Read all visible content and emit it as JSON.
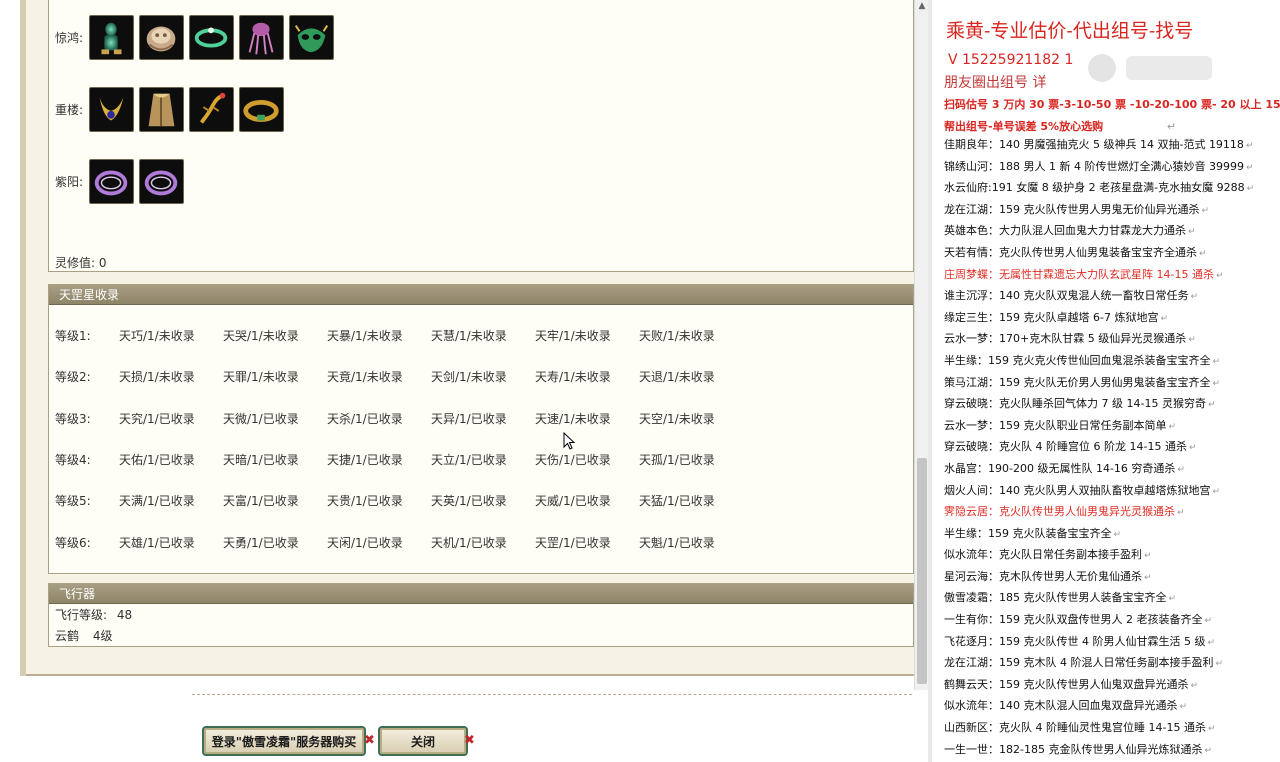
{
  "items": {
    "rows": [
      {
        "label": "惊鸿:",
        "icons": [
          "jade-figure-icon",
          "golden-hat-icon",
          "jade-ring-icon",
          "purple-squid-icon",
          "jade-mask-icon"
        ]
      },
      {
        "label": "重楼:",
        "icons": [
          "golden-horn-icon",
          "bronze-cloak-icon",
          "golden-scorpion-icon",
          "golden-belt-icon"
        ]
      },
      {
        "label": "紫阳:",
        "icons": [
          "purple-bracelet-icon",
          "purple-bracelet-icon"
        ]
      }
    ],
    "lingxiu_label": "灵修值:",
    "lingxiu_value": "0"
  },
  "tiangang": {
    "header": "天罡星收录",
    "rows": [
      {
        "level": "等级1:",
        "cells": [
          "天巧/1/未收录",
          "天哭/1/未收录",
          "天暴/1/未收录",
          "天慧/1/未收录",
          "天牢/1/未收录",
          "天败/1/未收录"
        ]
      },
      {
        "level": "等级2:",
        "cells": [
          "天损/1/未收录",
          "天罪/1/未收录",
          "天竟/1/未收录",
          "天剑/1/未收录",
          "天寿/1/未收录",
          "天退/1/未收录"
        ]
      },
      {
        "level": "等级3:",
        "cells": [
          "天究/1/已收录",
          "天微/1/已收录",
          "天杀/1/已收录",
          "天异/1/已收录",
          "天速/1/未收录",
          "天空/1/未收录"
        ]
      },
      {
        "level": "等级4:",
        "cells": [
          "天佑/1/已收录",
          "天暗/1/已收录",
          "天捷/1/已收录",
          "天立/1/已收录",
          "天伤/1/已收录",
          "天孤/1/已收录"
        ]
      },
      {
        "level": "等级5:",
        "cells": [
          "天满/1/已收录",
          "天富/1/已收录",
          "天贵/1/已收录",
          "天英/1/已收录",
          "天威/1/已收录",
          "天猛/1/已收录"
        ]
      },
      {
        "level": "等级6:",
        "cells": [
          "天雄/1/已收录",
          "天勇/1/已收录",
          "天闲/1/已收录",
          "天机/1/已收录",
          "天罡/1/已收录",
          "天魁/1/已收录"
        ]
      }
    ]
  },
  "flight": {
    "header": "飞行器",
    "level_label": "飞行等级:",
    "level_value": "48",
    "crane_label": "云鹤",
    "crane_value": "4级"
  },
  "buttons": {
    "buy_label": "登录\"傲雪凌霜\"服务器购买",
    "close_label": "关闭",
    "x_mark": "✖"
  },
  "right": {
    "title": "乘黄-专业估价-代出组号-找号",
    "phone": "V 15225921182    1",
    "circle": "朋友圈出组号    详",
    "price_line": "扫码估号 3 万内 30 票-3-10-50 票  -10-20-100 票- 20 以上 150",
    "help_line": "帮出组号-单号误差 5%放心选购",
    "return_mark": "↵",
    "list": [
      {
        "text": "佳期良年：140 男魔强抽克火 5 级神兵 14 双抽-范式 19118",
        "red": false
      },
      {
        "text": "锦绣山河：188 男人 1 新 4 阶传世燃灯全满心猿妙音 39999",
        "red": false
      },
      {
        "text": "水云仙府:191 女魔 8 级护身 2 老孩星盘满-克水抽女魔 9288",
        "red": false
      },
      {
        "text": "龙在江湖：159 克火队传世男人男鬼无价仙异光通杀",
        "red": false
      },
      {
        "text": "英雄本色：大力队混人回血鬼大力甘霖龙大力通杀",
        "red": false
      },
      {
        "text": "天若有情：克火队传世男人仙男鬼装备宝宝齐全通杀",
        "red": false
      },
      {
        "text": "庄周梦蝶：无属性甘霖遗忘大力队玄武星阵 14-15 通杀",
        "red": true
      },
      {
        "text": "谁主沉浮：140 克火队双鬼混人统一畜牧日常任务",
        "red": false
      },
      {
        "text": "缘定三生：159 克火队卓越塔 6-7 炼狱地宫",
        "red": false
      },
      {
        "text": "云水一梦：170+克木队甘霖 5 级仙异光灵猴通杀",
        "red": false
      },
      {
        "text": "半生缘：159 克火克火传世仙回血鬼混杀装备宝宝齐全",
        "red": false
      },
      {
        "text": "策马江湖：159 克火队无价男人男仙男鬼装备宝宝齐全",
        "red": false
      },
      {
        "text": "穿云破晓：克火队睡杀回气体力 7 级 14-15 灵猴穷奇",
        "red": false
      },
      {
        "text": "云水一梦：159 克火队职业日常任务副本简单",
        "red": false
      },
      {
        "text": "穿云破晓：克火队 4 阶睡宫位 6 阶龙 14-15 通杀",
        "red": false
      },
      {
        "text": "水晶宫：190-200 级无属性队 14-16 穷奇通杀",
        "red": false
      },
      {
        "text": "烟火人间：140 克火队男人双抽队畜牧卓越塔炼狱地宫",
        "red": false
      },
      {
        "text": "霁隐云居：克火队传世男人仙男鬼异光灵猴通杀",
        "red": true
      },
      {
        "text": "半生缘：159 克火队装备宝宝齐全",
        "red": false
      },
      {
        "text": "似水流年：克火队日常任务副本接手盈利",
        "red": false
      },
      {
        "text": "星河云海：克木队传世男人无价鬼仙通杀",
        "red": false
      },
      {
        "text": "傲雪凌霜：185 克火队传世男人装备宝宝齐全",
        "red": false
      },
      {
        "text": "一生有你：159 克火队双盘传世男人 2 老孩装备齐全",
        "red": false
      },
      {
        "text": "飞花逐月：159 克火队传世 4 阶男人仙甘霖生活 5 级",
        "red": false
      },
      {
        "text": "龙在江湖：159 克木队 4 阶混人日常任务副本接手盈利",
        "red": false
      },
      {
        "text": "鹤舞云天：159 克火队传世男人仙鬼双盘异光通杀",
        "red": false
      },
      {
        "text": "似水流年：140 克木队混人回血鬼双盘异光通杀",
        "red": false
      },
      {
        "text": "山西新区：克火队 4 阶睡仙灵性鬼宫位睡 14-15 通杀",
        "red": false
      },
      {
        "text": "一生一世：182-185 克金队传世男人仙异光炼狱通杀",
        "red": false
      }
    ]
  },
  "colors": {
    "accent_red": "#d8251f",
    "header_brown": "#9a9175",
    "panel_bg": "#f7f3e4"
  }
}
